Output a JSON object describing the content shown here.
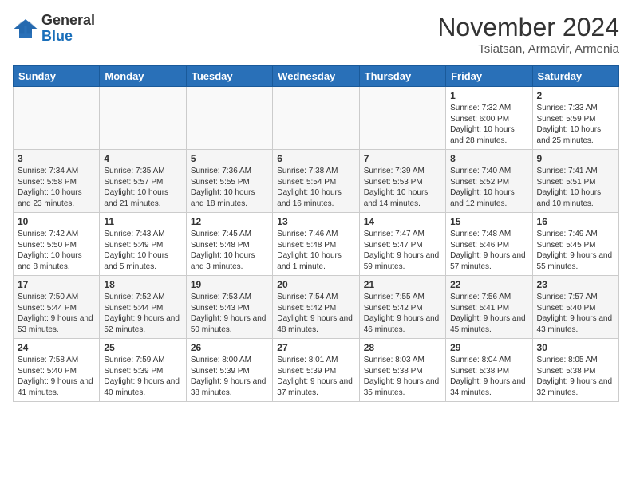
{
  "header": {
    "logo_line1": "General",
    "logo_line2": "Blue",
    "month": "November 2024",
    "location": "Tsiatsan, Armavir, Armenia"
  },
  "weekdays": [
    "Sunday",
    "Monday",
    "Tuesday",
    "Wednesday",
    "Thursday",
    "Friday",
    "Saturday"
  ],
  "weeks": [
    [
      {
        "day": "",
        "info": ""
      },
      {
        "day": "",
        "info": ""
      },
      {
        "day": "",
        "info": ""
      },
      {
        "day": "",
        "info": ""
      },
      {
        "day": "",
        "info": ""
      },
      {
        "day": "1",
        "info": "Sunrise: 7:32 AM\nSunset: 6:00 PM\nDaylight: 10 hours and 28 minutes."
      },
      {
        "day": "2",
        "info": "Sunrise: 7:33 AM\nSunset: 5:59 PM\nDaylight: 10 hours and 25 minutes."
      }
    ],
    [
      {
        "day": "3",
        "info": "Sunrise: 7:34 AM\nSunset: 5:58 PM\nDaylight: 10 hours and 23 minutes."
      },
      {
        "day": "4",
        "info": "Sunrise: 7:35 AM\nSunset: 5:57 PM\nDaylight: 10 hours and 21 minutes."
      },
      {
        "day": "5",
        "info": "Sunrise: 7:36 AM\nSunset: 5:55 PM\nDaylight: 10 hours and 18 minutes."
      },
      {
        "day": "6",
        "info": "Sunrise: 7:38 AM\nSunset: 5:54 PM\nDaylight: 10 hours and 16 minutes."
      },
      {
        "day": "7",
        "info": "Sunrise: 7:39 AM\nSunset: 5:53 PM\nDaylight: 10 hours and 14 minutes."
      },
      {
        "day": "8",
        "info": "Sunrise: 7:40 AM\nSunset: 5:52 PM\nDaylight: 10 hours and 12 minutes."
      },
      {
        "day": "9",
        "info": "Sunrise: 7:41 AM\nSunset: 5:51 PM\nDaylight: 10 hours and 10 minutes."
      }
    ],
    [
      {
        "day": "10",
        "info": "Sunrise: 7:42 AM\nSunset: 5:50 PM\nDaylight: 10 hours and 8 minutes."
      },
      {
        "day": "11",
        "info": "Sunrise: 7:43 AM\nSunset: 5:49 PM\nDaylight: 10 hours and 5 minutes."
      },
      {
        "day": "12",
        "info": "Sunrise: 7:45 AM\nSunset: 5:48 PM\nDaylight: 10 hours and 3 minutes."
      },
      {
        "day": "13",
        "info": "Sunrise: 7:46 AM\nSunset: 5:48 PM\nDaylight: 10 hours and 1 minute."
      },
      {
        "day": "14",
        "info": "Sunrise: 7:47 AM\nSunset: 5:47 PM\nDaylight: 9 hours and 59 minutes."
      },
      {
        "day": "15",
        "info": "Sunrise: 7:48 AM\nSunset: 5:46 PM\nDaylight: 9 hours and 57 minutes."
      },
      {
        "day": "16",
        "info": "Sunrise: 7:49 AM\nSunset: 5:45 PM\nDaylight: 9 hours and 55 minutes."
      }
    ],
    [
      {
        "day": "17",
        "info": "Sunrise: 7:50 AM\nSunset: 5:44 PM\nDaylight: 9 hours and 53 minutes."
      },
      {
        "day": "18",
        "info": "Sunrise: 7:52 AM\nSunset: 5:44 PM\nDaylight: 9 hours and 52 minutes."
      },
      {
        "day": "19",
        "info": "Sunrise: 7:53 AM\nSunset: 5:43 PM\nDaylight: 9 hours and 50 minutes."
      },
      {
        "day": "20",
        "info": "Sunrise: 7:54 AM\nSunset: 5:42 PM\nDaylight: 9 hours and 48 minutes."
      },
      {
        "day": "21",
        "info": "Sunrise: 7:55 AM\nSunset: 5:42 PM\nDaylight: 9 hours and 46 minutes."
      },
      {
        "day": "22",
        "info": "Sunrise: 7:56 AM\nSunset: 5:41 PM\nDaylight: 9 hours and 45 minutes."
      },
      {
        "day": "23",
        "info": "Sunrise: 7:57 AM\nSunset: 5:40 PM\nDaylight: 9 hours and 43 minutes."
      }
    ],
    [
      {
        "day": "24",
        "info": "Sunrise: 7:58 AM\nSunset: 5:40 PM\nDaylight: 9 hours and 41 minutes."
      },
      {
        "day": "25",
        "info": "Sunrise: 7:59 AM\nSunset: 5:39 PM\nDaylight: 9 hours and 40 minutes."
      },
      {
        "day": "26",
        "info": "Sunrise: 8:00 AM\nSunset: 5:39 PM\nDaylight: 9 hours and 38 minutes."
      },
      {
        "day": "27",
        "info": "Sunrise: 8:01 AM\nSunset: 5:39 PM\nDaylight: 9 hours and 37 minutes."
      },
      {
        "day": "28",
        "info": "Sunrise: 8:03 AM\nSunset: 5:38 PM\nDaylight: 9 hours and 35 minutes."
      },
      {
        "day": "29",
        "info": "Sunrise: 8:04 AM\nSunset: 5:38 PM\nDaylight: 9 hours and 34 minutes."
      },
      {
        "day": "30",
        "info": "Sunrise: 8:05 AM\nSunset: 5:38 PM\nDaylight: 9 hours and 32 minutes."
      }
    ]
  ]
}
